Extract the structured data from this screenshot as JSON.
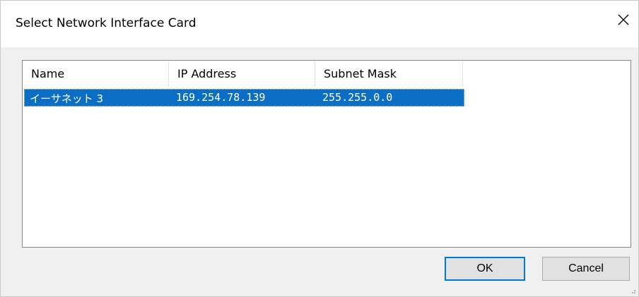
{
  "dialog": {
    "title": "Select Network Interface Card",
    "close_icon": "close-icon"
  },
  "table": {
    "columns": [
      "Name",
      "IP Address",
      "Subnet Mask"
    ],
    "rows": [
      {
        "name": "イーサネット 3",
        "ip_address": "169.254.78.139",
        "subnet_mask": "255.255.0.0",
        "selected": true
      }
    ]
  },
  "buttons": {
    "ok_label": "OK",
    "cancel_label": "Cancel"
  },
  "colors": {
    "selection": "#0a6fc4",
    "default_button_border": "#0078d7"
  }
}
